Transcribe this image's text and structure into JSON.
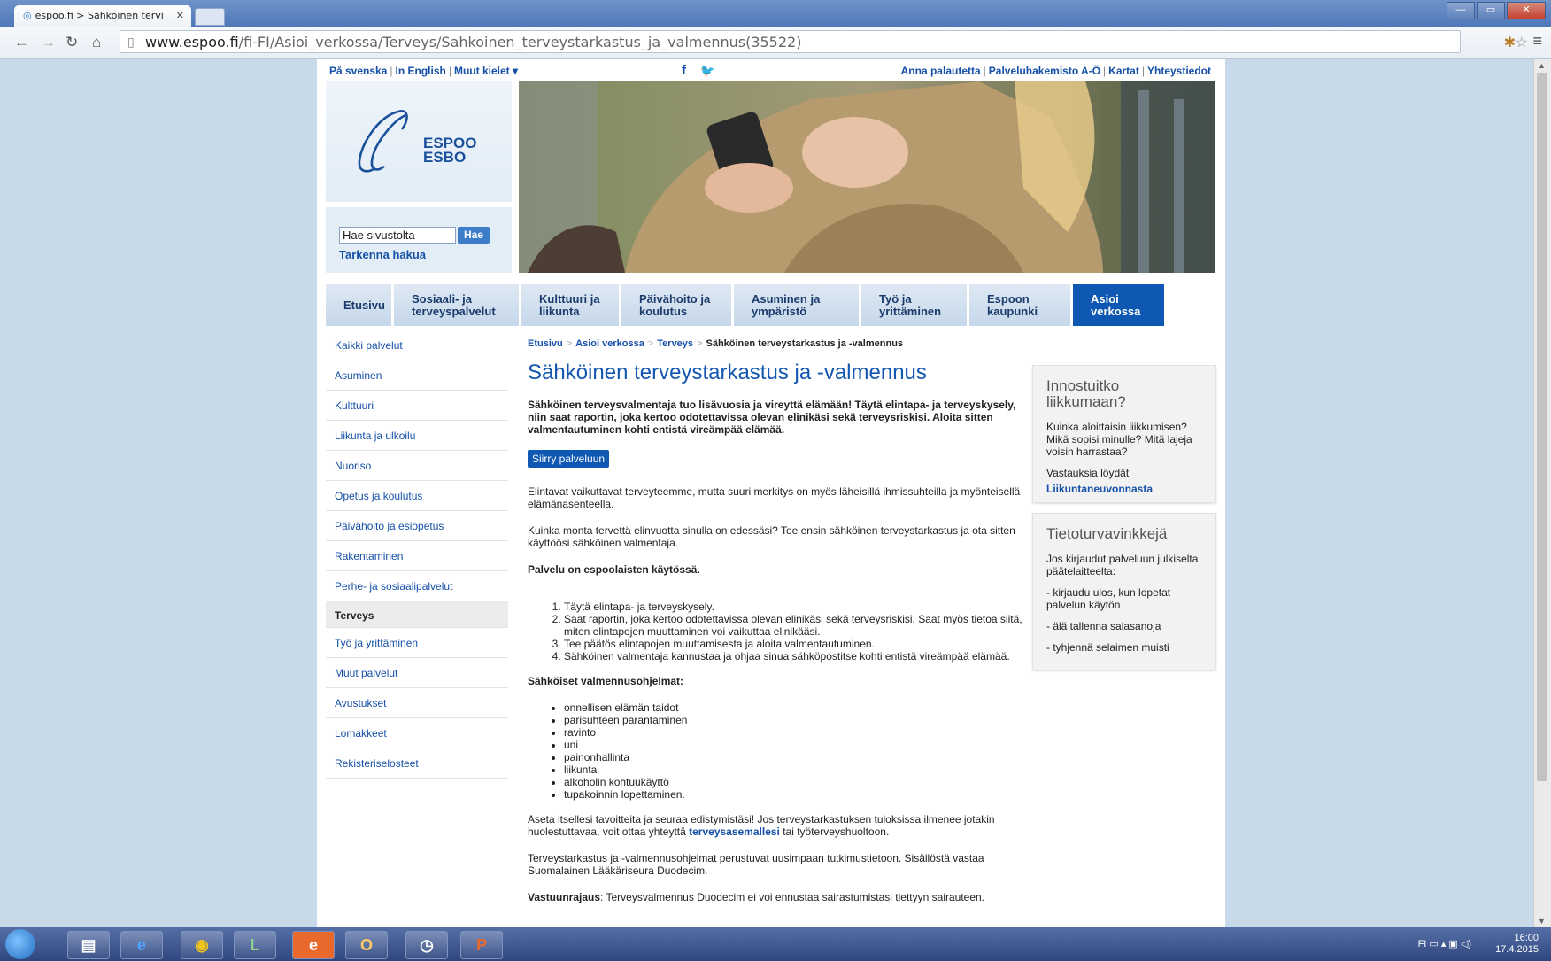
{
  "browser": {
    "tab_title": "espoo.fi > Sähköinen tervi",
    "url_host": "www.espoo.fi",
    "url_path": "/fi-FI/Asioi_verkossa/Terveys/Sahkoinen_terveystarkastus_ja_valmennus(35522)"
  },
  "topbar": {
    "lang_sv": "På svenska",
    "lang_en": "In English",
    "lang_more": "Muut kielet ▾",
    "facebook": "f",
    "twitter": "🐦",
    "feedback": "Anna palautetta",
    "directory": "Palveluhakemisto A-Ö",
    "maps": "Kartat",
    "contacts": "Yhteystiedot"
  },
  "logo": {
    "line1": "ESPOO",
    "line2": "ESBO"
  },
  "search": {
    "value": "Hae sivustolta",
    "button": "Hae",
    "advanced": "Tarkenna hakua"
  },
  "menu": [
    "Etusivu",
    "Sosiaali- ja terveyspalvelut",
    "Kulttuuri ja liikunta",
    "Päivähoito ja koulutus",
    "Asuminen ja ympäristö",
    "Työ ja yrittäminen",
    "Espoon kaupunki",
    "Asioi verkossa"
  ],
  "sidenav": [
    "Kaikki palvelut",
    "Asuminen",
    "Kulttuuri",
    "Liikunta ja ulkoilu",
    "Nuoriso",
    "Opetus ja koulutus",
    "Päivähoito ja esiopetus",
    "Rakentaminen",
    "Perhe- ja sosiaalipalvelut",
    "Terveys",
    "Työ ja yrittäminen",
    "Muut palvelut",
    "Avustukset",
    "Lomakkeet",
    "Rekisteriselosteet"
  ],
  "breadcrumb": [
    "Etusivu",
    "Asioi verkossa",
    "Terveys",
    "Sähköinen terveystarkastus ja -valmennus"
  ],
  "title": "Sähköinen terveystarkastus ja -valmennus",
  "content": {
    "lead": "Sähköinen terveysvalmentaja tuo lisävuosia ja vireyttä elämään! Täytä elintapa- ja terveyskysely, niin saat raportin, joka kertoo odotettavissa olevan elinikäsi sekä terveysriskisi. Aloita sitten valmentautuminen kohti entistä vireämpää elämää.",
    "button": "Siirry palveluun",
    "p1": "Elintavat vaikuttavat terveyteemme, mutta suuri merkitys on myös läheisillä ihmissuhteilla ja myönteisellä elämänasenteella.",
    "p2": "Kuinka monta tervettä elinvuotta sinulla on edessäsi? Tee ensin sähköinen terveystarkastus ja ota sitten käyttöösi sähköinen valmentaja.",
    "p3": "Palvelu on espoolaisten käytössä.",
    "steps": [
      "Täytä elintapa- ja terveyskysely.",
      "Saat raportin, joka kertoo odotettavissa olevan elinikäsi sekä terveysriskisi. Saat myös tietoa siitä, miten elintapojen muuttaminen voi vaikuttaa elinikääsi.",
      "Tee päätös elintapojen muuttamisesta ja aloita valmentautuminen.",
      "Sähköinen valmentaja kannustaa ja ohjaa sinua sähköpostitse kohti entistä vireämpää elämää."
    ],
    "programs_heading": "Sähköiset valmennusohjelmat:",
    "programs": [
      "onnellisen elämän taidot",
      "parisuhteen parantaminen",
      "ravinto",
      "uni",
      "painonhallinta",
      "liikunta",
      "alkoholin kohtuukäyttö",
      "tupakoinnin lopettaminen."
    ],
    "p4_before": "Aseta itsellesi tavoitteita ja seuraa edistymistäsi! Jos terveystarkastuksen tuloksissa ilmenee jotakin huolestuttavaa, voit ottaa yhteyttä ",
    "p4_link": "terveysasemallesi",
    "p4_after": " tai työterveyshuoltoon.",
    "p5": "Terveystarkastus ja -valmennusohjelmat perustuvat uusimpaan tutkimustietoon. Sisällöstä vastaa Suomalainen Lääkäriseura Duodecim.",
    "p6_bold": "Vastuunrajaus",
    "p6": ": Terveysvalmennus Duodecim ei voi ennustaa sairastumistasi tiettyyn sairauteen."
  },
  "box1": {
    "title": "Innostuitko liikkumaan?",
    "p1": "Kuinka aloittaisin liikkumisen? Mikä sopisi minulle? Mitä lajeja voisin harrastaa?",
    "p2": "Vastauksia löydät",
    "link": "Liikuntaneuvonnasta"
  },
  "box2": {
    "title": "Tietoturvavinkkejä",
    "p1": "Jos kirjaudut palveluun julkiselta päätelaitteelta:",
    "items": [
      "- kirjaudu ulos, kun lopetat palvelun käytön",
      "- älä tallenna salasanoja",
      "- tyhjennä selaimen muisti"
    ]
  },
  "taskbar": {
    "lang": "FI",
    "time": "16:00",
    "date": "17.4.2015"
  }
}
